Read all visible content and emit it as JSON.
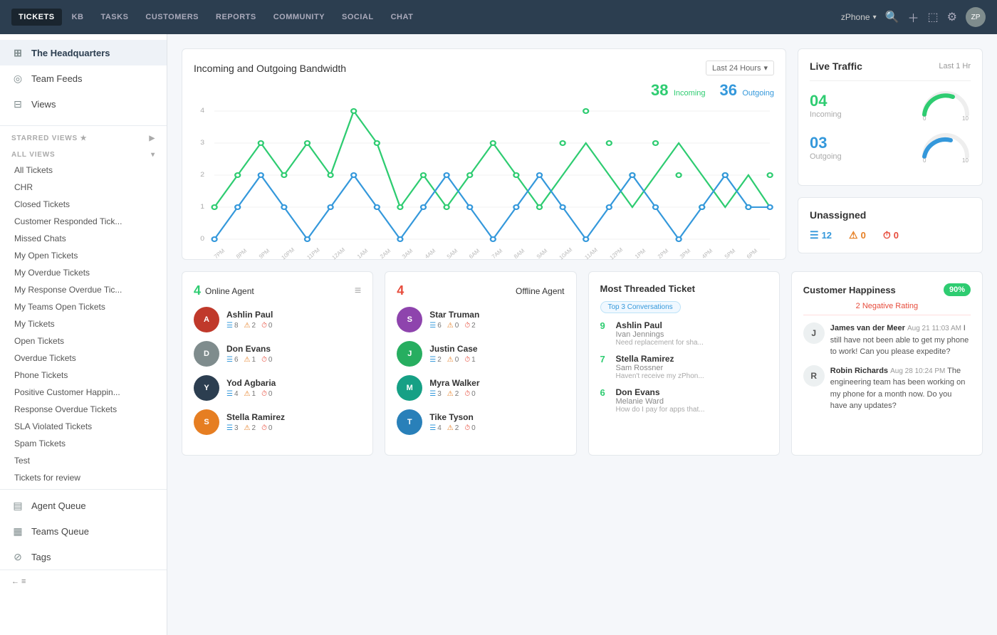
{
  "nav": {
    "items": [
      {
        "label": "TICKETS",
        "active": true
      },
      {
        "label": "KB",
        "active": false
      },
      {
        "label": "TASKS",
        "active": false
      },
      {
        "label": "CUSTOMERS",
        "active": false
      },
      {
        "label": "REPORTS",
        "active": false
      },
      {
        "label": "COMMUNITY",
        "active": false
      },
      {
        "label": "SOCIAL",
        "active": false
      },
      {
        "label": "CHAT",
        "active": false
      }
    ],
    "phone": "zPhone",
    "avatar_initials": "ZP"
  },
  "sidebar": {
    "top_items": [
      {
        "label": "The Headquarters",
        "icon": "⊞",
        "active": true
      },
      {
        "label": "Team Feeds",
        "icon": "◎",
        "active": false
      },
      {
        "label": "Views",
        "icon": "⊟",
        "active": false
      }
    ],
    "starred_label": "STARRED VIEWS ★",
    "all_views_label": "ALL VIEWS",
    "view_items": [
      "All Tickets",
      "CHR",
      "Closed Tickets",
      "Customer Responded Tick...",
      "Missed Chats",
      "My Open Tickets",
      "My Overdue Tickets",
      "My Response Overdue Tic...",
      "My Teams Open Tickets",
      "My Tickets",
      "Open Tickets",
      "Overdue Tickets",
      "Phone Tickets",
      "Positive Customer Happin...",
      "Response Overdue Tickets",
      "SLA Violated Tickets",
      "Spam Tickets",
      "Test",
      "Tickets for review"
    ],
    "bottom_items": [
      {
        "label": "Agent Queue",
        "icon": "▤"
      },
      {
        "label": "Teams Queue",
        "icon": "▤"
      },
      {
        "label": "Tags",
        "icon": "⊘"
      }
    ],
    "footer_label": "← ≡"
  },
  "bandwidth": {
    "title": "Incoming and Outgoing Bandwidth",
    "time_filter": "Last 24 Hours",
    "incoming_count": "38",
    "outgoing_count": "36",
    "incoming_label": "Incoming",
    "outgoing_label": "Outgoing",
    "y_labels": [
      "4",
      "3",
      "2",
      "1",
      "0"
    ],
    "x_labels": [
      "7PM",
      "8PM",
      "9PM",
      "10PM",
      "11PM",
      "12AM",
      "1AM",
      "2AM",
      "3AM",
      "4AM",
      "5AM",
      "6AM",
      "7AM",
      "8AM",
      "9AM",
      "10AM",
      "11AM",
      "12PM",
      "1PM",
      "2PM",
      "3PM",
      "4PM",
      "5PM",
      "6PM"
    ]
  },
  "live_traffic": {
    "title": "Live Traffic",
    "sub": "Last 1 Hr",
    "incoming_count": "04",
    "incoming_label": "Incoming",
    "outgoing_count": "03",
    "outgoing_label": "Outgoing"
  },
  "unassigned": {
    "title": "Unassigned",
    "stats": [
      {
        "value": "12",
        "type": "blue",
        "icon": "ticket"
      },
      {
        "value": "0",
        "type": "orange",
        "icon": "warn"
      },
      {
        "value": "0",
        "type": "red",
        "icon": "clock"
      }
    ]
  },
  "online_agents": {
    "count": "4",
    "title": "Online Agent",
    "agents": [
      {
        "name": "Ashlin Paul",
        "tickets": "8",
        "warn": "2",
        "clock": "0",
        "color": "#c0392b"
      },
      {
        "name": "Don Evans",
        "tickets": "6",
        "warn": "1",
        "clock": "0",
        "color": "#7f8c8d"
      },
      {
        "name": "Yod Agbaria",
        "tickets": "4",
        "warn": "1",
        "clock": "0",
        "color": "#2c3e50"
      },
      {
        "name": "Stella Ramirez",
        "tickets": "3",
        "warn": "2",
        "clock": "0",
        "color": "#e67e22"
      }
    ]
  },
  "offline_agents": {
    "count": "4",
    "title": "Offline Agent",
    "agents": [
      {
        "name": "Star Truman",
        "tickets": "6",
        "warn": "0",
        "clock": "2",
        "color": "#8e44ad"
      },
      {
        "name": "Justin Case",
        "tickets": "2",
        "warn": "0",
        "clock": "1",
        "color": "#27ae60"
      },
      {
        "name": "Myra Walker",
        "tickets": "3",
        "warn": "2",
        "clock": "0",
        "color": "#16a085"
      },
      {
        "name": "Tike Tyson",
        "tickets": "4",
        "warn": "2",
        "clock": "0",
        "color": "#2980b9"
      }
    ]
  },
  "most_threaded": {
    "title": "Most Threaded Ticket",
    "badge": "Top 3 Conversations",
    "items": [
      {
        "num": "9",
        "name": "Ashlin Paul",
        "sub": "Ivan Jennings",
        "preview": "Need replacement for sha..."
      },
      {
        "num": "7",
        "name": "Stella Ramirez",
        "sub": "Sam Rossner",
        "preview": "Haven't receive my zPhon..."
      },
      {
        "num": "6",
        "name": "Don Evans",
        "sub": "Melanie Ward",
        "preview": "How do I pay for apps that..."
      }
    ]
  },
  "customer_happiness": {
    "title": "Customer Happiness",
    "percentage": "90%",
    "negative_label": "2 Negative Rating",
    "reviews": [
      {
        "initial": "J",
        "name": "James van der Meer",
        "date": "Aug 21 11:03 AM",
        "text": "I still have not been able to get my phone to work! Can you please expedite?"
      },
      {
        "initial": "R",
        "name": "Robin Richards",
        "date": "Aug 28 10:24 PM",
        "text": "The engineering team has been working on my phone for a month now. Do you have any updates?"
      }
    ]
  }
}
